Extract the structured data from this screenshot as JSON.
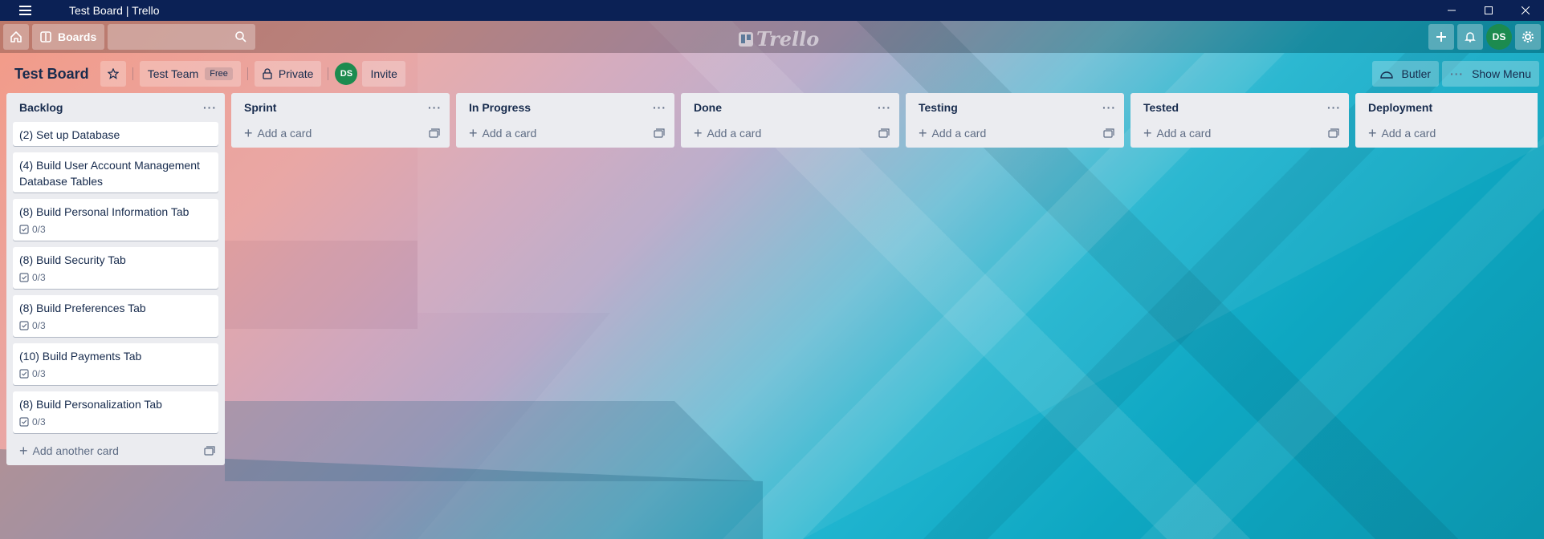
{
  "window": {
    "title": "Test Board | Trello",
    "controls": [
      "minimize-icon",
      "maximize-icon",
      "close-icon"
    ]
  },
  "header": {
    "boards_label": "Boards",
    "search_placeholder": "",
    "logo_text": "Trello",
    "avatar_initials": "DS"
  },
  "board": {
    "title": "Test Board",
    "team_label": "Test Team",
    "team_badge": "Free",
    "visibility_label": "Private",
    "member_initials": "DS",
    "invite_label": "Invite",
    "butler_label": "Butler",
    "show_menu_label": "Show Menu"
  },
  "lists": [
    {
      "title": "Backlog",
      "cards": [
        {
          "title": "(2) Set up Database",
          "checklist": ""
        },
        {
          "title": "(4) Build User Account Management Database Tables",
          "checklist": ""
        },
        {
          "title": "(8) Build Personal Information Tab",
          "checklist": "0/3"
        },
        {
          "title": "(8) Build Security Tab",
          "checklist": "0/3"
        },
        {
          "title": "(8) Build Preferences Tab",
          "checklist": "0/3"
        },
        {
          "title": "(10) Build Payments Tab",
          "checklist": "0/3"
        },
        {
          "title": "(8) Build Personalization Tab",
          "checklist": "0/3"
        }
      ],
      "add_label": "Add another card"
    },
    {
      "title": "Sprint",
      "cards": [],
      "add_label": "Add a card"
    },
    {
      "title": "In Progress",
      "cards": [],
      "add_label": "Add a card"
    },
    {
      "title": "Done",
      "cards": [],
      "add_label": "Add a card"
    },
    {
      "title": "Testing",
      "cards": [],
      "add_label": "Add a card"
    },
    {
      "title": "Tested",
      "cards": [],
      "add_label": "Add a card"
    },
    {
      "title": "Deployment",
      "cards": [],
      "add_label": "Add a card"
    }
  ],
  "colors": {
    "titlebar": "#0b2155",
    "list_bg": "#ebecf0",
    "avatar": "#1c8b4f"
  }
}
